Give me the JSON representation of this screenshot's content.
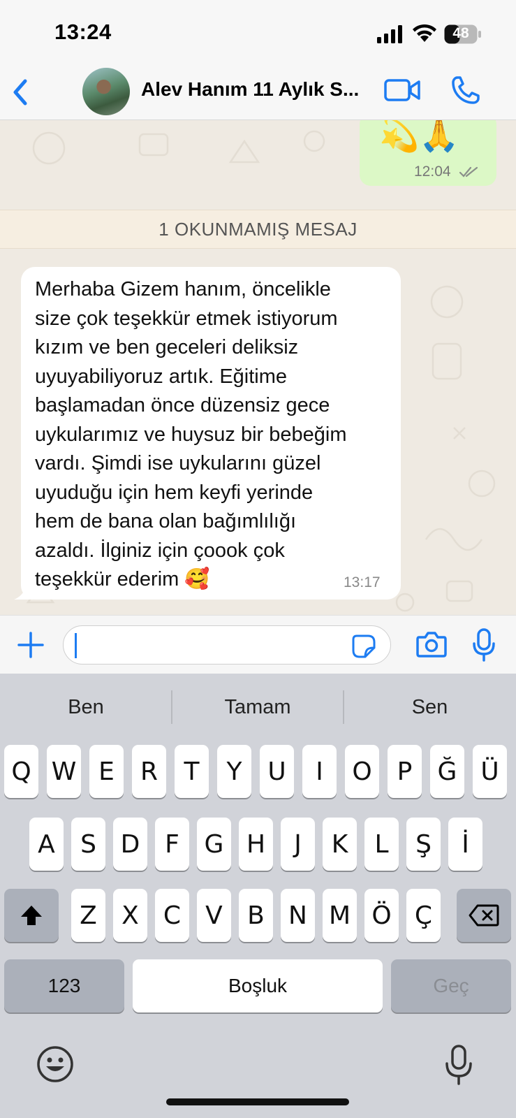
{
  "status_bar": {
    "time": "13:24",
    "battery": "48"
  },
  "header": {
    "contact_name": "Alev Hanım 11 Aylık S..."
  },
  "chat": {
    "sent_message": {
      "emojis": "💫🙏",
      "time": "12:04"
    },
    "unread_banner": "1 OKUNMAMIŞ MESAJ",
    "received_message": {
      "text": "Merhaba Gizem hanım, öncelikle\nsize çok teşekkür etmek istiyorum\nkızım ve ben geceleri deliksiz\nuyuyabiliyoruz artık. Eğitime\nbaşlamadan önce düzensiz gece\nuykularımız ve huysuz bir bebeğim\nvardı. Şimdi ise uykularını güzel\nuyuduğu için hem keyfi yerinde\nhem de bana olan bağımlılığı\nazaldı. İlginiz için çoook çok\nteşekkür ederim 🥰",
      "time": "13:17"
    }
  },
  "input": {
    "value": ""
  },
  "keyboard": {
    "suggestions": [
      "Ben",
      "Tamam",
      "Sen"
    ],
    "row1": [
      "Q",
      "W",
      "E",
      "R",
      "T",
      "Y",
      "U",
      "I",
      "O",
      "P",
      "Ğ",
      "Ü"
    ],
    "row2": [
      "A",
      "S",
      "D",
      "F",
      "G",
      "H",
      "J",
      "K",
      "L",
      "Ş",
      "İ"
    ],
    "row3": [
      "Z",
      "X",
      "C",
      "V",
      "B",
      "N",
      "M",
      "Ö",
      "Ç"
    ],
    "numbers_label": "123",
    "space_label": "Boşluk",
    "return_label": "Geç"
  },
  "colors": {
    "accent_blue": "#1d7cf2",
    "sent_bubble": "#dcf8c6",
    "chat_background": "#efeae2",
    "keyboard_background": "#d1d3d9"
  }
}
